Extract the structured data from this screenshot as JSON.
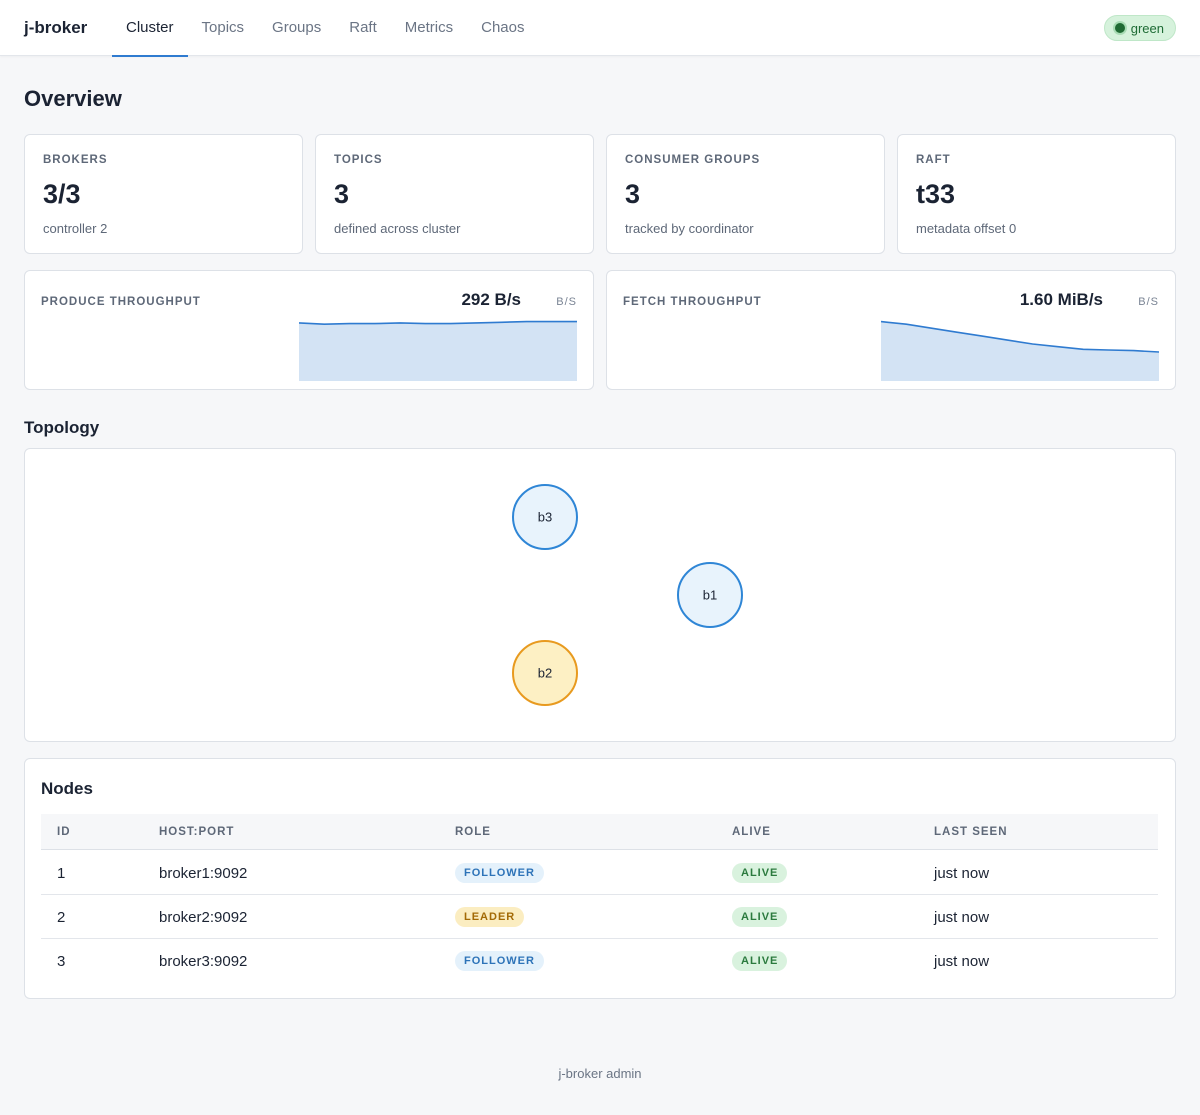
{
  "app": {
    "brand": "j-broker",
    "status": "green",
    "footer": "j-broker admin"
  },
  "nav": {
    "tabs": [
      {
        "label": "Cluster",
        "active": true
      },
      {
        "label": "Topics"
      },
      {
        "label": "Groups"
      },
      {
        "label": "Raft"
      },
      {
        "label": "Metrics"
      },
      {
        "label": "Chaos"
      }
    ]
  },
  "overview": {
    "title": "Overview",
    "stats": [
      {
        "label": "BROKERS",
        "value": "3/3",
        "sub": "controller 2"
      },
      {
        "label": "TOPICS",
        "value": "3",
        "sub": "defined across cluster"
      },
      {
        "label": "CONSUMER GROUPS",
        "value": "3",
        "sub": "tracked by coordinator"
      },
      {
        "label": "RAFT",
        "value": "t33",
        "sub": "metadata offset 0"
      }
    ],
    "throughput": [
      {
        "label": "PRODUCE THROUGHPUT",
        "value": "292 B/s",
        "unit": "B/S",
        "trend": [
          0.88,
          0.86,
          0.87,
          0.87,
          0.88,
          0.87,
          0.87,
          0.88,
          0.89,
          0.9,
          0.9,
          0.9
        ]
      },
      {
        "label": "FETCH THROUGHPUT",
        "value": "1.60 MiB/s",
        "unit": "B/S",
        "trend": [
          0.9,
          0.86,
          0.8,
          0.74,
          0.68,
          0.62,
          0.56,
          0.52,
          0.48,
          0.47,
          0.46,
          0.44
        ]
      }
    ]
  },
  "topology": {
    "title": "Topology",
    "nodes": [
      {
        "id": "b3",
        "role": "follower"
      },
      {
        "id": "b1",
        "role": "follower"
      },
      {
        "id": "b2",
        "role": "leader"
      }
    ]
  },
  "nodes": {
    "title": "Nodes",
    "columns": [
      "ID",
      "HOST:PORT",
      "ROLE",
      "ALIVE",
      "LAST SEEN"
    ],
    "rows": [
      {
        "id": "1",
        "host": "broker1:9092",
        "role": "FOLLOWER",
        "alive": "ALIVE",
        "last_seen": "just now"
      },
      {
        "id": "2",
        "host": "broker2:9092",
        "role": "LEADER",
        "alive": "ALIVE",
        "last_seen": "just now"
      },
      {
        "id": "3",
        "host": "broker3:9092",
        "role": "FOLLOWER",
        "alive": "ALIVE",
        "last_seen": "just now"
      }
    ]
  },
  "colors": {
    "accent": "#2f7bd0",
    "follower": "#2f86d6",
    "leader": "#e89a1f",
    "alive": "#2b7a3e"
  }
}
